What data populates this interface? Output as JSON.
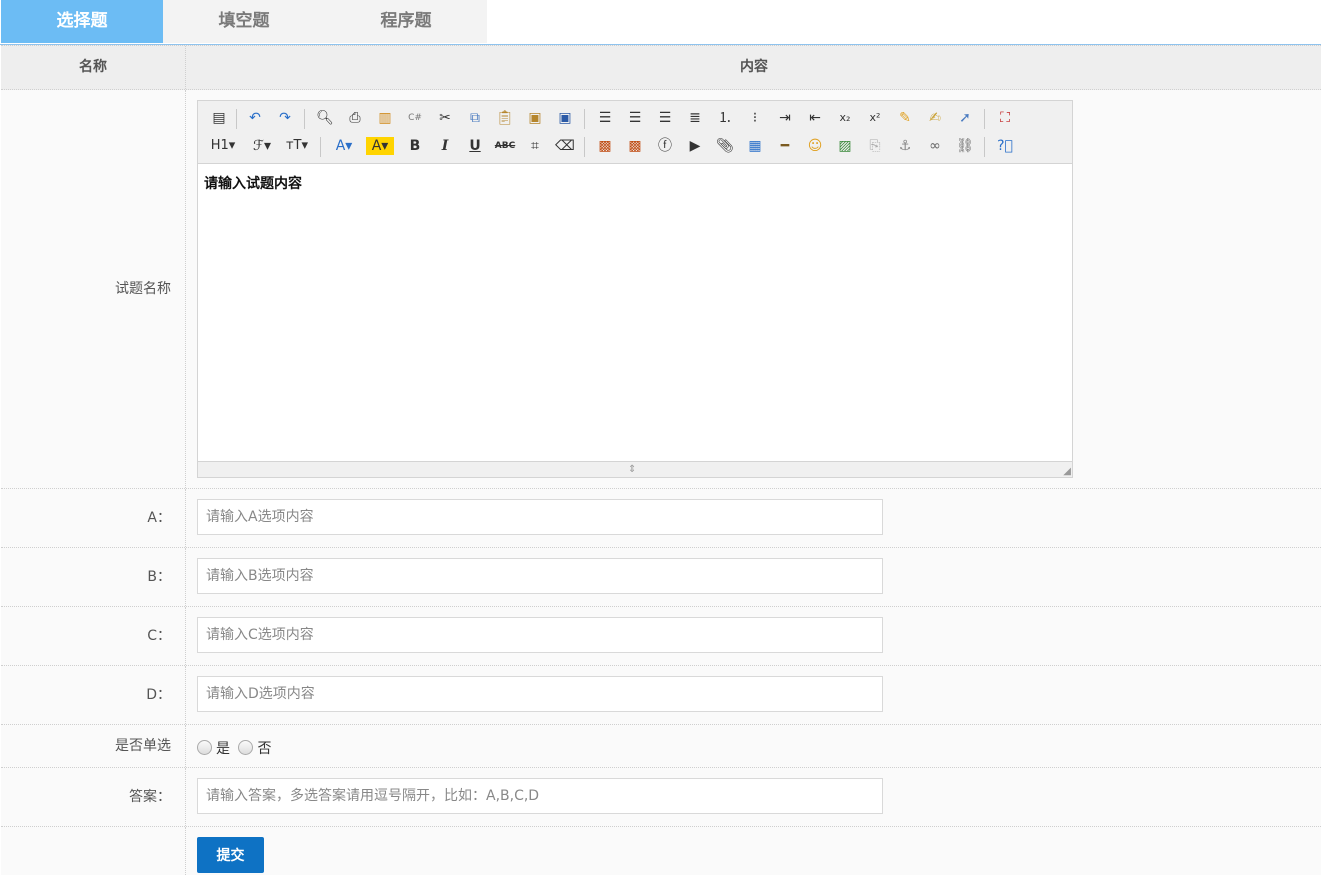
{
  "tabs": [
    {
      "label": "选择题",
      "active": true
    },
    {
      "label": "填空题",
      "active": false
    },
    {
      "label": "程序题",
      "active": false
    }
  ],
  "table_header": {
    "name_col": "名称",
    "content_col": "内容"
  },
  "question": {
    "label": "试题名称",
    "editor_content": "请输入试题内容"
  },
  "options": [
    {
      "label": "A：",
      "placeholder": "请输入A选项内容"
    },
    {
      "label": "B：",
      "placeholder": "请输入B选项内容"
    },
    {
      "label": "C：",
      "placeholder": "请输入C选项内容"
    },
    {
      "label": "D：",
      "placeholder": "请输入D选项内容"
    }
  ],
  "single_choice": {
    "label": "是否单选",
    "yes": "是",
    "no": "否"
  },
  "answer": {
    "label": "答案：",
    "placeholder": "请输入答案，多选答案请用逗号隔开，比如：A,B,C,D"
  },
  "submit": {
    "label": "提交"
  },
  "colors": {
    "tab_active": "#6cbcf4",
    "submit": "#0e72c4"
  },
  "toolbar_icons_row1": [
    "source-icon",
    "undo-icon",
    "redo-icon",
    "preview-icon",
    "print-icon",
    "template-icon",
    "code-icon",
    "cut-icon",
    "copy-icon",
    "paste-icon",
    "paste-plain-icon",
    "paste-word-icon",
    "align-left-icon",
    "align-center-icon",
    "align-right-icon",
    "justify-icon",
    "ordered-list-icon",
    "unordered-list-icon",
    "indent-icon",
    "outdent-icon",
    "subscript-icon",
    "superscript-icon",
    "clear-format-icon",
    "select-all-icon",
    "cursor-icon",
    "fullscreen-icon"
  ],
  "toolbar_icons_row2": [
    "heading-icon",
    "font-family-icon",
    "font-size-icon",
    "font-color-icon",
    "highlight-icon",
    "bold-icon",
    "italic-icon",
    "underline-icon",
    "strikethrough-icon",
    "line-height-icon",
    "eraser-icon",
    "image-icon",
    "multi-image-icon",
    "flash-icon",
    "media-icon",
    "attachment-icon",
    "table-icon",
    "hr-icon",
    "emoticon-icon",
    "map-icon",
    "pagebreak-icon",
    "anchor-icon",
    "link-icon",
    "unlink-icon",
    "help-icon"
  ]
}
